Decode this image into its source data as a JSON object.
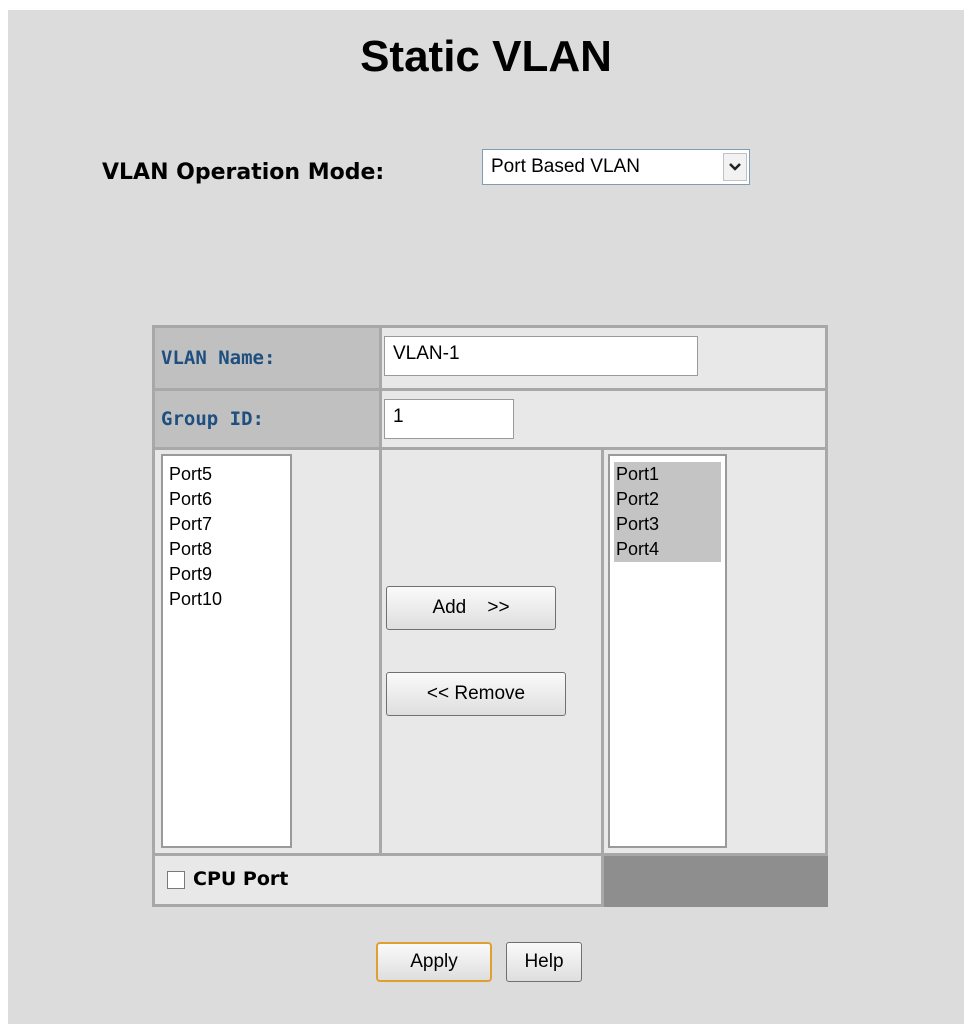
{
  "page": {
    "title": "Static VLAN"
  },
  "mode": {
    "label": "VLAN Operation Mode:",
    "value": "Port Based VLAN"
  },
  "form": {
    "vlan_name_label": "VLAN Name:",
    "vlan_name_value": "VLAN-1",
    "group_id_label": "Group ID:",
    "group_id_value": "1",
    "available_ports": [
      "Port5",
      "Port6",
      "Port7",
      "Port8",
      "Port9",
      "Port10"
    ],
    "member_ports": [
      "Port1",
      "Port2",
      "Port3",
      "Port4"
    ],
    "add_label": "Add    >>",
    "remove_label": "<< Remove",
    "cpu_port_label": "CPU Port",
    "cpu_port_checked": false
  },
  "buttons": {
    "apply": "Apply",
    "help": "Help"
  },
  "colors": {
    "background": "#dcdcdc",
    "label_text": "#1f4f7f",
    "label_bg": "#c0c0c0",
    "selected_item_bg": "#c4c4c4",
    "apply_border": "#e0a030"
  }
}
